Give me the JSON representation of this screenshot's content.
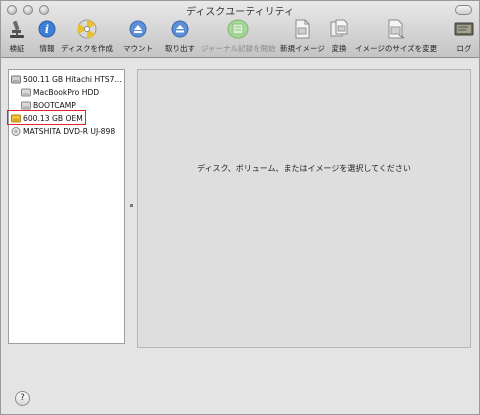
{
  "window": {
    "title": "ディスクユーティリティ"
  },
  "toolbar": {
    "items": [
      {
        "label": "検証",
        "icon": "microscope-icon",
        "enabled": true
      },
      {
        "label": "情報",
        "icon": "info-icon",
        "enabled": true
      },
      {
        "label": "ディスクを作成",
        "icon": "burn-disc-icon",
        "enabled": true
      },
      {
        "label": "マウント",
        "icon": "mount-icon",
        "enabled": true
      },
      {
        "label": "取り出す",
        "icon": "eject-icon",
        "enabled": true
      },
      {
        "label": "ジャーナル記録を開始",
        "icon": "journal-icon",
        "enabled": false
      },
      {
        "label": "新規イメージ",
        "icon": "new-image-icon",
        "enabled": true
      },
      {
        "label": "変換",
        "icon": "convert-icon",
        "enabled": true
      },
      {
        "label": "イメージのサイズを変更",
        "icon": "resize-image-icon",
        "enabled": true
      },
      {
        "label": "ログ",
        "icon": "log-icon",
        "enabled": true
      }
    ]
  },
  "sidebar": {
    "items": [
      {
        "label": "500.11 GB Hitachi HTS7...",
        "icon": "hard-disk-icon"
      },
      {
        "label": "MacBookPro HDD",
        "icon": "volume-icon"
      },
      {
        "label": "BOOTCAMP",
        "icon": "volume-icon"
      },
      {
        "label": "600.13 GB OEM",
        "icon": "external-disk-icon"
      },
      {
        "label": "MATSHITA DVD-R UJ-898",
        "icon": "optical-drive-icon"
      }
    ]
  },
  "detail": {
    "message": "ディスク、ボリューム、またはイメージを選択してください"
  },
  "footer": {
    "help_label": "?"
  },
  "colors": {
    "highlight_border": "#e0262a"
  }
}
